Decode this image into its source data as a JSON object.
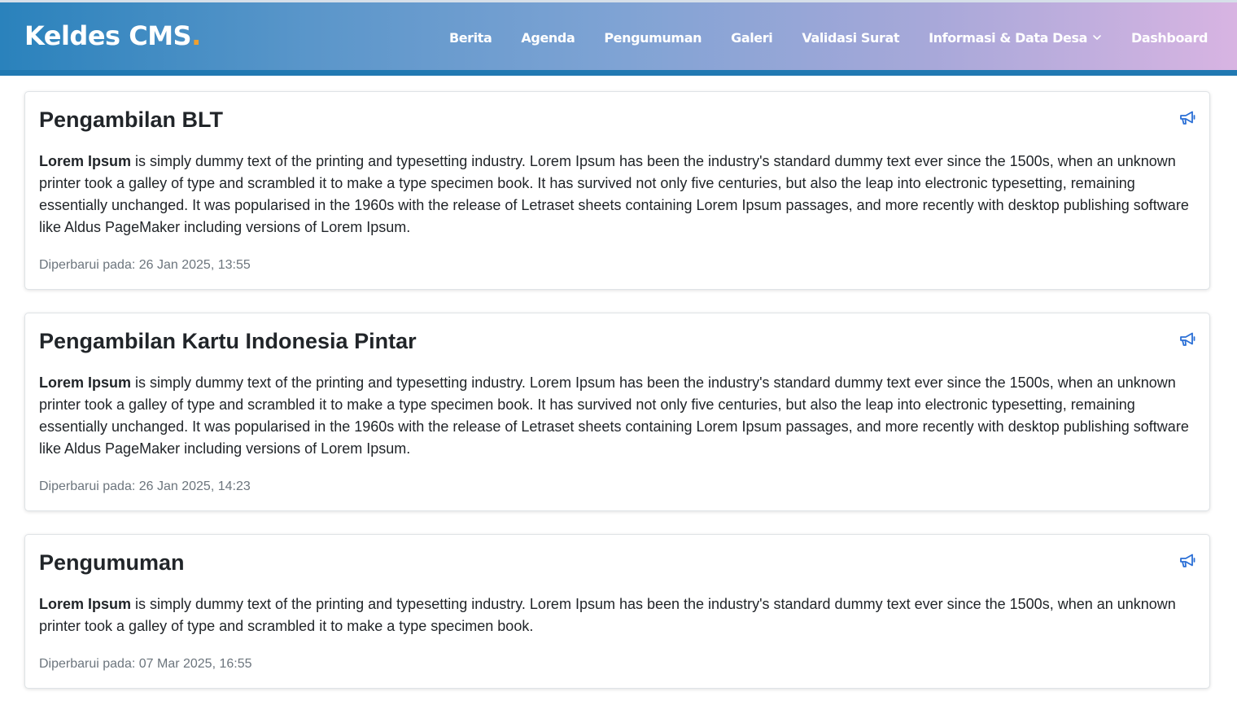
{
  "header": {
    "logo_text": "Keldes CMS",
    "logo_dot": ".",
    "nav": [
      {
        "label": "Berita"
      },
      {
        "label": "Agenda"
      },
      {
        "label": "Pengumuman"
      },
      {
        "label": "Galeri"
      },
      {
        "label": "Validasi Surat"
      },
      {
        "label": "Informasi & Data Desa"
      },
      {
        "label": "Dashboard"
      }
    ]
  },
  "colors": {
    "gradient_start": "#2a82bc",
    "gradient_end": "#d8b4e2",
    "accent": "#2179b2",
    "logo_dot": "#f0a030",
    "icon": "#2a6fd6"
  },
  "icons": {
    "card_icon": "megaphone-icon",
    "dropdown_icon": "chevron-down-icon"
  },
  "announcements": [
    {
      "title": "Pengambilan BLT",
      "body_bold": "Lorem Ipsum",
      "body_rest": " is simply dummy text of the printing and typesetting industry. Lorem Ipsum has been the industry's standard dummy text ever since the 1500s, when an unknown printer took a galley of type and scrambled it to make a type specimen book. It has survived not only five centuries, but also the leap into electronic typesetting, remaining essentially unchanged. It was popularised in the 1960s with the release of Letraset sheets containing Lorem Ipsum passages, and more recently with desktop publishing software like Aldus PageMaker including versions of Lorem Ipsum.",
      "updated": "Diperbarui pada: 26 Jan 2025, 13:55"
    },
    {
      "title": "Pengambilan Kartu Indonesia Pintar",
      "body_bold": "Lorem Ipsum",
      "body_rest": " is simply dummy text of the printing and typesetting industry. Lorem Ipsum has been the industry's standard dummy text ever since the 1500s, when an unknown printer took a galley of type and scrambled it to make a type specimen book. It has survived not only five centuries, but also the leap into electronic typesetting, remaining essentially unchanged. It was popularised in the 1960s with the release of Letraset sheets containing Lorem Ipsum passages, and more recently with desktop publishing software like Aldus PageMaker including versions of Lorem Ipsum.",
      "updated": "Diperbarui pada: 26 Jan 2025, 14:23"
    },
    {
      "title": "Pengumuman",
      "body_bold": "Lorem Ipsum",
      "body_rest": " is simply dummy text of the printing and typesetting industry. Lorem Ipsum has been the industry's standard dummy text ever since the 1500s, when an unknown printer took a galley of type and scrambled it to make a type specimen book.",
      "updated": "Diperbarui pada: 07 Mar 2025, 16:55"
    }
  ]
}
